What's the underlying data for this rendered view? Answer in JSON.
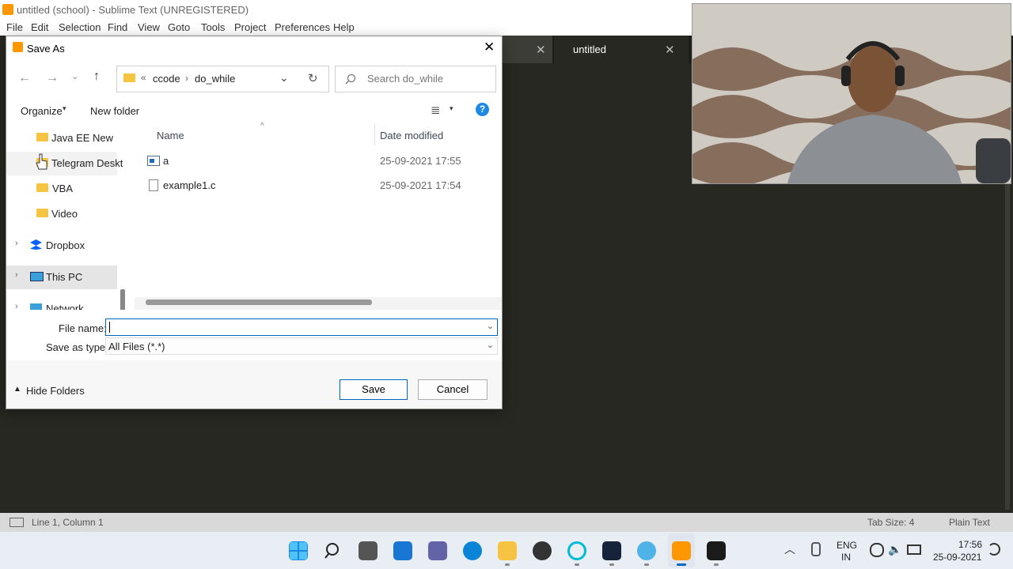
{
  "app": {
    "window_title": "untitled (school) - Sublime Text (UNREGISTERED)",
    "menu": [
      "File",
      "Edit",
      "Selection",
      "Find",
      "View",
      "Goto",
      "Tools",
      "Project",
      "Preferences",
      "Help"
    ],
    "tab_active": "untitled"
  },
  "statusbar": {
    "position": "Line 1, Column 1",
    "tab_size": "Tab Size: 4",
    "syntax": "Plain Text"
  },
  "dialog": {
    "title": "Save As",
    "breadcrumb": [
      "ccode",
      "do_while"
    ],
    "breadcrumb_prefix": "«",
    "search_placeholder": "Search do_while",
    "organize_label": "Organize",
    "new_folder_label": "New folder",
    "nav_items": [
      {
        "label": "Java EE New",
        "type": "folder"
      },
      {
        "label": "Telegram Deskt",
        "type": "folder"
      },
      {
        "label": "VBA",
        "type": "folder"
      },
      {
        "label": "Video",
        "type": "folder"
      },
      {
        "label": "Dropbox",
        "type": "dropbox"
      },
      {
        "label": "This PC",
        "type": "pc"
      },
      {
        "label": "Network",
        "type": "network"
      }
    ],
    "columns": {
      "name": "Name",
      "date": "Date modified"
    },
    "files": [
      {
        "name": "a",
        "date": "25-09-2021 17:55",
        "icon": "exe-icon"
      },
      {
        "name": "example1.c",
        "date": "25-09-2021 17:54",
        "icon": "file-icon"
      }
    ],
    "file_name_label": "File name:",
    "file_name_value": "",
    "save_type_label": "Save as type:",
    "save_type_value": "All Files (*.*)",
    "hide_folders_label": "Hide Folders",
    "save_label": "Save",
    "cancel_label": "Cancel"
  },
  "taskbar": {
    "lang_1": "ENG",
    "lang_2": "IN",
    "time": "17:56",
    "date": "25-09-2021"
  }
}
